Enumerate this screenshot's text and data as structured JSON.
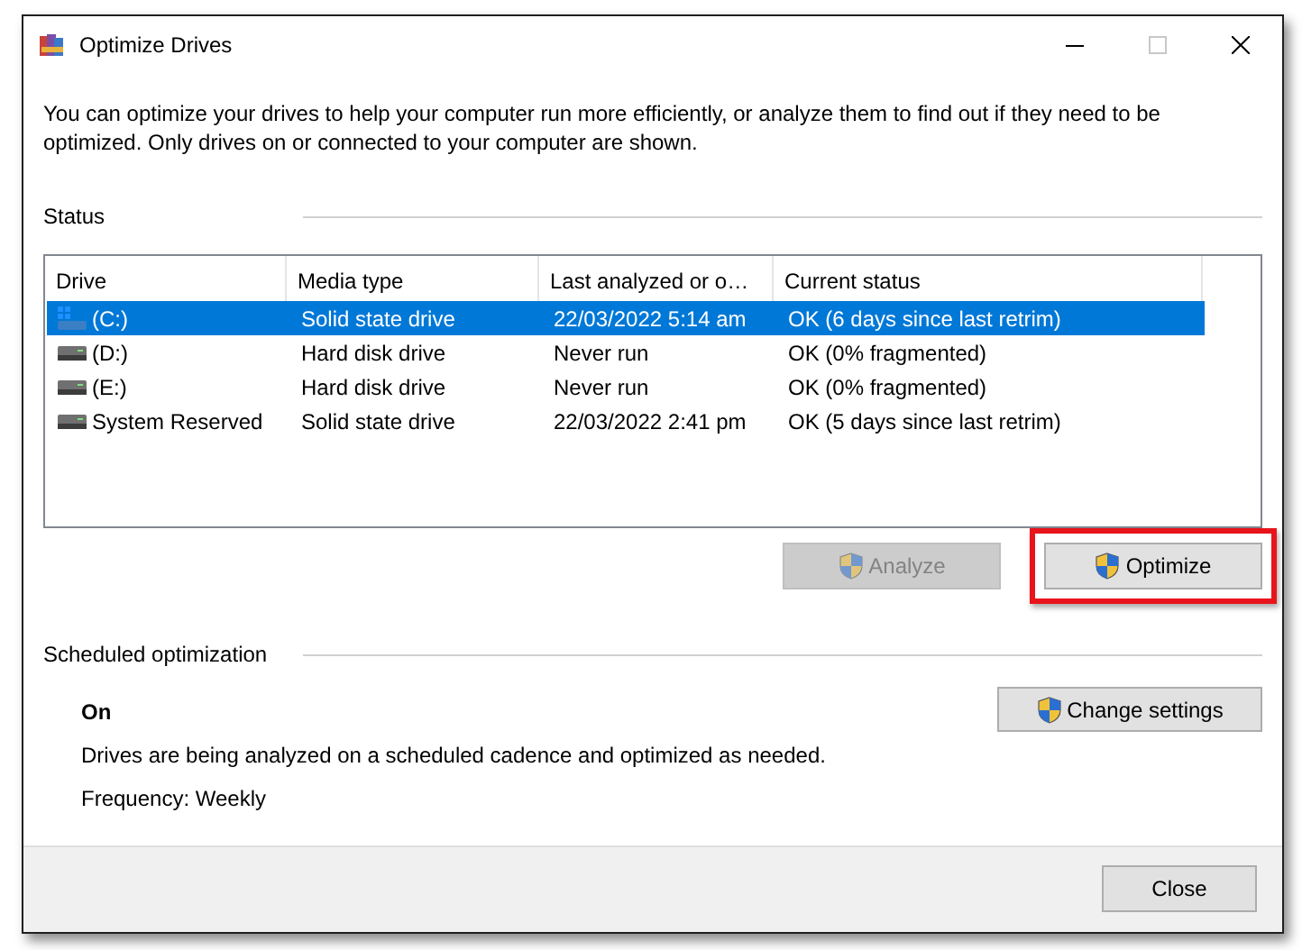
{
  "window": {
    "title": "Optimize Drives"
  },
  "description": "You can optimize your drives to help your computer run more efficiently, or analyze them to find out if they need to be optimized. Only drives on or connected to your computer are shown.",
  "status": {
    "heading": "Status",
    "columns": [
      "Drive",
      "Media type",
      "Last analyzed or o…",
      "Current status"
    ],
    "rows": [
      {
        "kind": "system",
        "drive": "(C:)",
        "media_type": "Solid state drive",
        "last_analyzed": "22/03/2022 5:14 am",
        "current_status": "OK (6 days since last retrim)",
        "selected": true
      },
      {
        "kind": "plain",
        "drive": "(D:)",
        "media_type": "Hard disk drive",
        "last_analyzed": "Never run",
        "current_status": "OK (0% fragmented)",
        "selected": false
      },
      {
        "kind": "plain",
        "drive": "(E:)",
        "media_type": "Hard disk drive",
        "last_analyzed": "Never run",
        "current_status": "OK (0% fragmented)",
        "selected": false
      },
      {
        "kind": "plain",
        "drive": "System Reserved",
        "media_type": "Solid state drive",
        "last_analyzed": "22/03/2022 2:41 pm",
        "current_status": "OK (5 days since last retrim)",
        "selected": false
      }
    ],
    "buttons": [
      {
        "label": "Analyze",
        "disabled": true,
        "highlighted": false
      },
      {
        "label": "Optimize",
        "disabled": false,
        "highlighted": true
      }
    ]
  },
  "schedule": {
    "heading": "Scheduled optimization",
    "state": "On",
    "description": "Drives are being analyzed on a scheduled cadence and optimized as needed.",
    "frequency": "Frequency: Weekly",
    "button": "Change settings"
  },
  "footer": {
    "button": "Close"
  }
}
